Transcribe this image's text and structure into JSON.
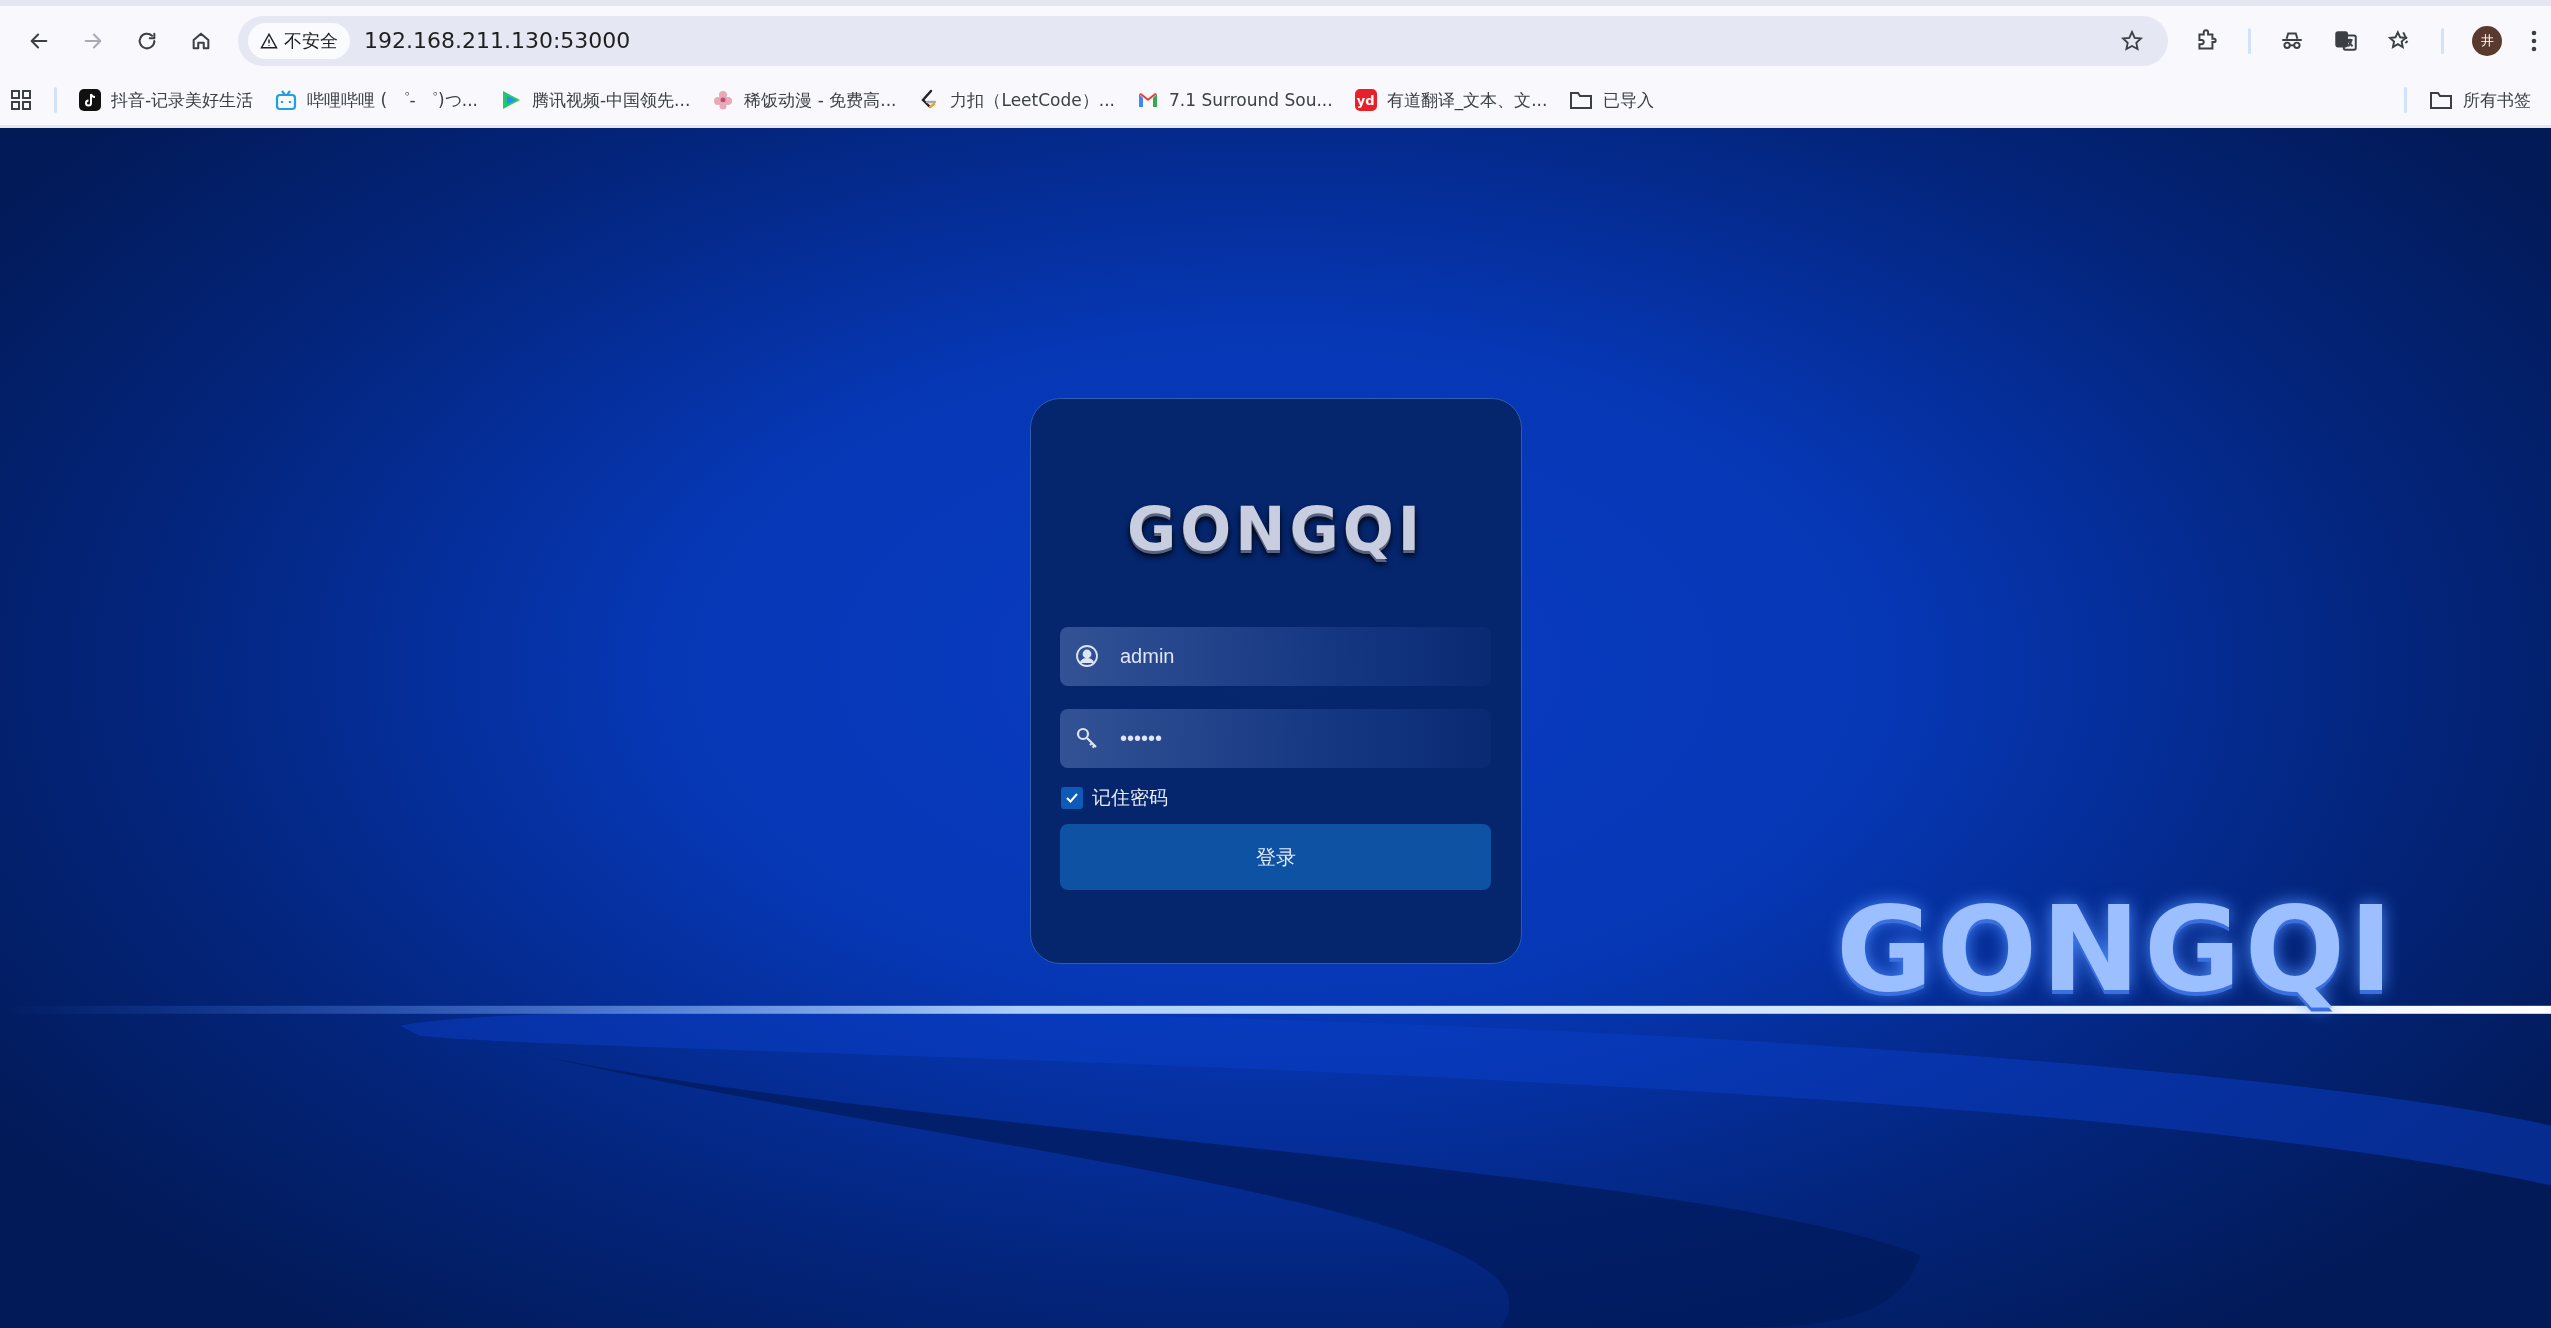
{
  "browser": {
    "nav": [
      {
        "kind": "back",
        "disabled": false
      },
      {
        "kind": "forward",
        "disabled": true
      },
      {
        "kind": "reload",
        "disabled": false
      },
      {
        "kind": "home",
        "disabled": false
      }
    ],
    "address_bar": {
      "security_label": "不安全",
      "url": "192.168.211.130:53000",
      "bookmarked": false
    },
    "toolbar_icons": [
      {
        "kind": "extension"
      },
      {
        "kind": "divider"
      },
      {
        "kind": "incognito"
      },
      {
        "kind": "translate"
      },
      {
        "kind": "favorites"
      },
      {
        "kind": "divider"
      }
    ],
    "profile_initial": "井",
    "bookmarks": [
      {
        "kind": "tiktok",
        "label": "抖音-记录美好生活"
      },
      {
        "kind": "tv",
        "label": "哔哩哔哩 ( ゜- ゜)つ..."
      },
      {
        "kind": "play",
        "label": "腾讯视频-中国领先..."
      },
      {
        "kind": "flower",
        "label": "稀饭动漫 - 免费高..."
      },
      {
        "kind": "leetcode",
        "label": "力扣（LeetCode）..."
      },
      {
        "kind": "mail",
        "label": "7.1 Surround Sou..."
      },
      {
        "kind": "badge",
        "badge_text": "yd",
        "label": "有道翻译_文本、文..."
      },
      {
        "kind": "folder",
        "label": "已导入"
      }
    ],
    "all_bookmarks": "所有书签"
  },
  "login": {
    "logo": "GONGQI",
    "username": "admin",
    "password": "••••••",
    "remember": {
      "label": "记住密码",
      "checked": true
    },
    "submit": "登录"
  },
  "background_logo": "GONGQI"
}
